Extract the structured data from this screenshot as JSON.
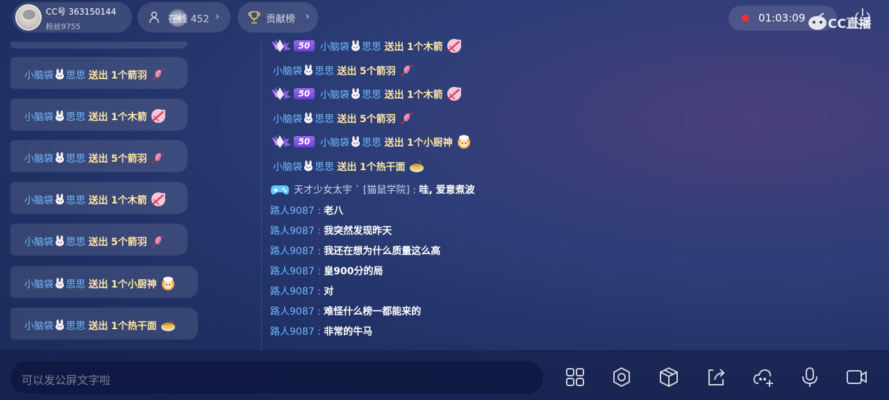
{
  "header": {
    "cc_id": "CC号 363150144",
    "fans": "粉丝9755",
    "viewers_label": "在线 452",
    "ranking_label": "贡献榜",
    "timer": "01:03:09",
    "logo_text": "CC直播"
  },
  "left_feed": [
    {
      "name": "小脑袋",
      "name2": "思思",
      "action": "送出",
      "qty": "1个箭羽",
      "gift": "arrow-feather"
    },
    {
      "name": "小脑袋",
      "name2": "思思",
      "action": "送出",
      "qty": "1个木箭",
      "gift": "wooden-arrow"
    },
    {
      "name": "小脑袋",
      "name2": "思思",
      "action": "送出",
      "qty": "5个箭羽",
      "gift": "arrow-feather"
    },
    {
      "name": "小脑袋",
      "name2": "思思",
      "action": "送出",
      "qty": "1个木箭",
      "gift": "wooden-arrow"
    },
    {
      "name": "小脑袋",
      "name2": "思思",
      "action": "送出",
      "qty": "5个箭羽",
      "gift": "arrow-feather"
    },
    {
      "name": "小脑袋",
      "name2": "思思",
      "action": "送出",
      "qty": "1个小厨神",
      "gift": "little-chef"
    },
    {
      "name": "小脑袋",
      "name2": "思思",
      "action": "送出",
      "qty": "1个热干面",
      "gift": "hot-noodles"
    }
  ],
  "chat": {
    "badge_level": "50",
    "gifts": [
      {
        "name": "小脑袋",
        "name2": "思思",
        "action": "送出",
        "qty": "1个木箭"
      },
      {
        "name": "小脑袋",
        "name2": "思思",
        "action": "送出",
        "qty": "5个箭羽"
      },
      {
        "name": "小脑袋",
        "name2": "思思",
        "action": "送出",
        "qty": "1个木箭"
      },
      {
        "name": "小脑袋",
        "name2": "思思",
        "action": "送出",
        "qty": "5个箭羽"
      },
      {
        "name": "小脑袋",
        "name2": "思思",
        "action": "送出",
        "qty": "1个小厨神"
      },
      {
        "name": "小脑袋",
        "name2": "思思",
        "action": "送出",
        "qty": "1个热干面"
      }
    ],
    "system_user": "天才少女太宇 ` [猫鼠学院] :",
    "system_msg": "哇, 爱意煮波",
    "messages": [
      {
        "user": "路人9087 :",
        "text": "老八"
      },
      {
        "user": "路人9087 :",
        "text": "我突然发现昨天"
      },
      {
        "user": "路人9087 :",
        "text": "我还在想为什么质量这么高"
      },
      {
        "user": "路人9087 :",
        "text": "皇900分的局"
      },
      {
        "user": "路人9087 :",
        "text": "对"
      },
      {
        "user": "路人9087 :",
        "text": "难怪什么榜一都能来的"
      },
      {
        "user": "路人9087 :",
        "text": "非常的牛马"
      }
    ]
  },
  "input": {
    "placeholder": "可以发公屏文字啦"
  },
  "toolbar": [
    "apps-icon",
    "settings-icon",
    "box-icon",
    "share-icon",
    "cloud-add-icon",
    "mic-icon",
    "camera-icon"
  ],
  "colors": {
    "name": "#6fb9ff",
    "action": "#ffe7a6",
    "rec": "#ff2d2d",
    "badge": "#7d4fe6"
  }
}
